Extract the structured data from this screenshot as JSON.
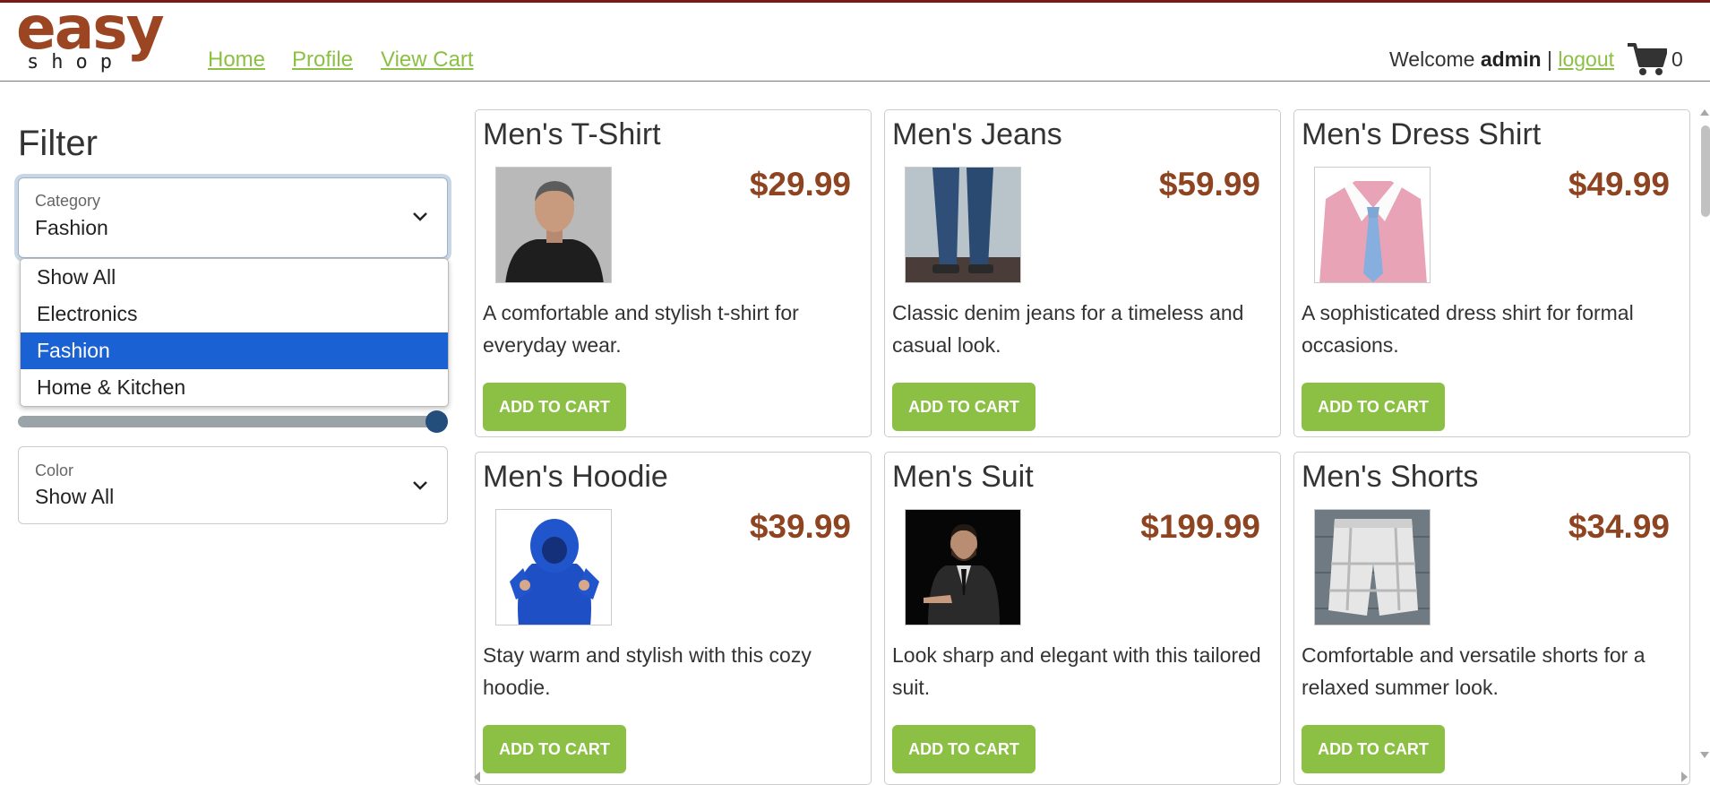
{
  "brand": {
    "logo_main": "easy",
    "logo_sub": "shop"
  },
  "nav": {
    "home": "Home",
    "profile": "Profile",
    "cart": "View Cart"
  },
  "user": {
    "welcome": "Welcome",
    "name": "admin",
    "separator": "|",
    "logout": "logout",
    "cart_count": "0"
  },
  "filter": {
    "title": "Filter",
    "category": {
      "label": "Category",
      "value": "Fashion",
      "options": [
        "Show All",
        "Electronics",
        "Fashion",
        "Home & Kitchen"
      ],
      "selected_index": 2
    },
    "price_slider_value_fraction": 1.0,
    "color": {
      "label": "Color",
      "value": "Show All"
    }
  },
  "products": [
    {
      "name": "Men's T-Shirt",
      "price": "$29.99",
      "description": "A comfortable and stylish t-shirt for everyday wear.",
      "button": "ADD TO CART",
      "image": "man-in-black-tshirt"
    },
    {
      "name": "Men's Jeans",
      "price": "$59.99",
      "description": "Classic denim jeans for a timeless and casual look.",
      "button": "ADD TO CART",
      "image": "blue-jeans-legs"
    },
    {
      "name": "Men's Dress Shirt",
      "price": "$49.99",
      "description": "A sophisticated dress shirt for formal occasions.",
      "button": "ADD TO CART",
      "image": "pink-shirt-with-tie"
    },
    {
      "name": "Men's Hoodie",
      "price": "$39.99",
      "description": "Stay warm and stylish with this cozy hoodie.",
      "button": "ADD TO CART",
      "image": "blue-hoodie"
    },
    {
      "name": "Men's Suit",
      "price": "$199.99",
      "description": "Look sharp and elegant with this tailored suit.",
      "button": "ADD TO CART",
      "image": "man-in-dark-suit"
    },
    {
      "name": "Men's Shorts",
      "price": "$34.99",
      "description": "Comfortable and versatile shorts for a relaxed summer look.",
      "button": "ADD TO CART",
      "image": "plaid-cargo-shorts"
    }
  ],
  "colors": {
    "accent": "#8cc044",
    "brand": "#9c4522",
    "price": "#8e4420",
    "selected": "#1a62d4",
    "slider": "#234d7a"
  }
}
